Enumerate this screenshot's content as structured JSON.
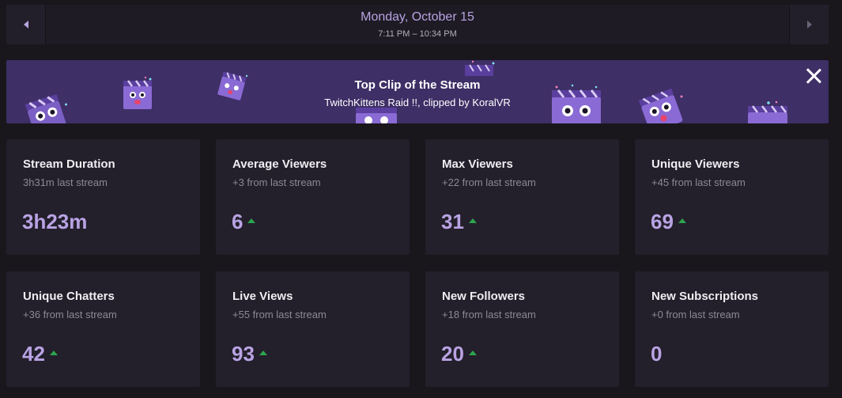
{
  "header": {
    "date": "Monday, October 15",
    "time_range": "7:11 PM – 10:34 PM"
  },
  "banner": {
    "title": "Top Clip of the Stream",
    "subtitle": "TwitchKittens Raid !!, clipped by KoralVR"
  },
  "colors": {
    "background": "#19171c",
    "card": "#231f2b",
    "banner": "#3e2f66",
    "accent": "#b9a3e3",
    "increase": "#2da44e"
  },
  "icons": {
    "prev": "chevron-left-icon",
    "next": "chevron-right-icon",
    "close": "close-icon",
    "trend_up": "trend-up-icon"
  },
  "stats": [
    {
      "title": "Stream Duration",
      "sub": "3h31m last stream",
      "value": "3h23m",
      "up": false
    },
    {
      "title": "Average Viewers",
      "sub": "+3 from last stream",
      "value": "6",
      "up": true
    },
    {
      "title": "Max Viewers",
      "sub": "+22 from last stream",
      "value": "31",
      "up": true
    },
    {
      "title": "Unique Viewers",
      "sub": "+45 from last stream",
      "value": "69",
      "up": true
    },
    {
      "title": "Unique Chatters",
      "sub": "+36 from last stream",
      "value": "42",
      "up": true
    },
    {
      "title": "Live Views",
      "sub": "+55 from last stream",
      "value": "93",
      "up": true
    },
    {
      "title": "New Followers",
      "sub": "+18 from last stream",
      "value": "20",
      "up": true
    },
    {
      "title": "New Subscriptions",
      "sub": "+0 from last stream",
      "value": "0",
      "up": false
    }
  ]
}
